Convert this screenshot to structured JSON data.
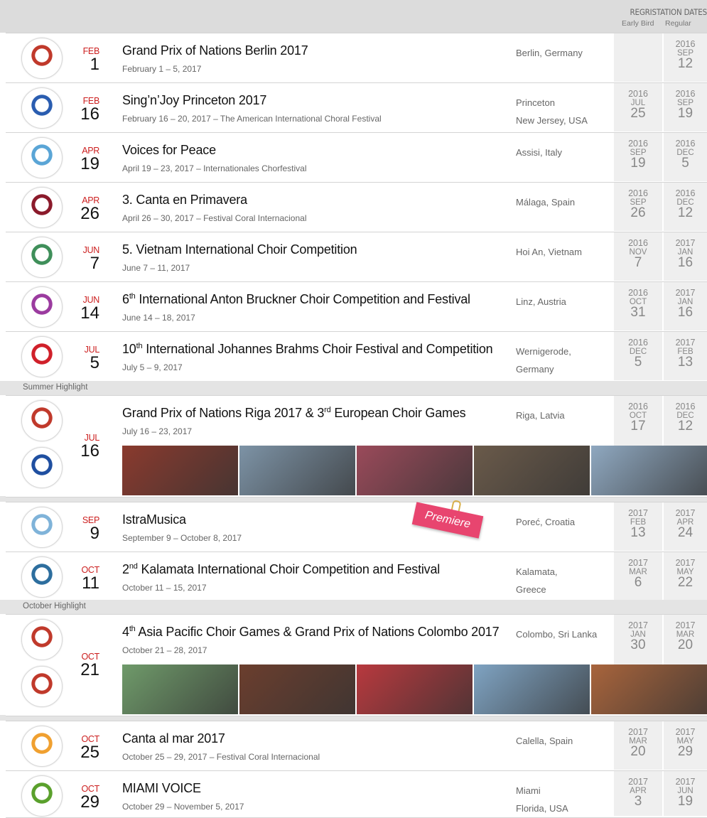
{
  "header": {
    "registration_title": "REGRISTATION DATES",
    "early_bird_label": "Early Bird",
    "regular_label": "Regular"
  },
  "highlights": {
    "summer": "Summer Highlight",
    "october": "October Highlight"
  },
  "premiere_label": "Premiere",
  "events": [
    {
      "logo": "grand-prix-of-nations-logo",
      "logo_color": "#c0392b",
      "month": "FEB",
      "day": "1",
      "title": "Grand Prix of Nations Berlin 2017",
      "title_sup": "",
      "title_rest": "",
      "subtitle": "February 1 – 5, 2017",
      "location_line1": "Berlin, Germany",
      "location_line2": "",
      "early_bird": null,
      "regular": {
        "year": "2016",
        "month": "SEP",
        "day": "12"
      }
    },
    {
      "logo": "sing-n-joy-logo",
      "logo_color": "#2a5db0",
      "month": "FEB",
      "day": "16",
      "title": "Sing’n’Joy Princeton 2017",
      "title_sup": "",
      "title_rest": "",
      "subtitle": "February 16 – 20, 2017 – The American International Choral Festival",
      "location_line1": "Princeton",
      "location_line2": "New Jersey, USA",
      "early_bird": {
        "year": "2016",
        "month": "JUL",
        "day": "25"
      },
      "regular": {
        "year": "2016",
        "month": "SEP",
        "day": "19"
      }
    },
    {
      "logo": "voices-for-peace-dove-logo",
      "logo_color": "#5aa5d6",
      "month": "APR",
      "day": "19",
      "title": "Voices for Peace",
      "title_sup": "",
      "title_rest": "",
      "subtitle": "April 19 – 23, 2017 – Internationales Chorfestival",
      "location_line1": "Assisi, Italy",
      "location_line2": "",
      "early_bird": {
        "year": "2016",
        "month": "SEP",
        "day": "19"
      },
      "regular": {
        "year": "2016",
        "month": "DEC",
        "day": "5"
      }
    },
    {
      "logo": "malaga-logo",
      "logo_color": "#8b1a2b",
      "month": "APR",
      "day": "26",
      "title": "3. Canta en Primavera",
      "title_sup": "",
      "title_rest": "",
      "subtitle": "April 26 – 30, 2017 – Festival Coral Internacional",
      "location_line1": "Málaga, Spain",
      "location_line2": "",
      "early_bird": {
        "year": "2016",
        "month": "SEP",
        "day": "26"
      },
      "regular": {
        "year": "2016",
        "month": "DEC",
        "day": "12"
      }
    },
    {
      "logo": "vietnam-choir-logo",
      "logo_color": "#3f8f5a",
      "month": "JUN",
      "day": "7",
      "title": "5. Vietnam International Choir Competition",
      "title_sup": "",
      "title_rest": "",
      "subtitle": "June 7 – 11, 2017",
      "location_line1": "Hoi An, Vietnam",
      "location_line2": "",
      "early_bird": {
        "year": "2016",
        "month": "NOV",
        "day": "7"
      },
      "regular": {
        "year": "2017",
        "month": "JAN",
        "day": "16"
      }
    },
    {
      "logo": "anton-bruckner-logo",
      "logo_color": "#9b3b9f",
      "month": "JUN",
      "day": "14",
      "title": "6",
      "title_sup": "th",
      "title_rest": " International Anton Bruckner Choir Competition and Festival",
      "subtitle": "June 14 – 18, 2017",
      "location_line1": "Linz, Austria",
      "location_line2": "",
      "early_bird": {
        "year": "2016",
        "month": "OCT",
        "day": "31"
      },
      "regular": {
        "year": "2017",
        "month": "JAN",
        "day": "16"
      }
    },
    {
      "logo": "brahms-10-logo",
      "logo_color": "#d0202a",
      "month": "JUL",
      "day": "5",
      "title": "10",
      "title_sup": "th",
      "title_rest": " International Johannes Brahms Choir Festival and Competition",
      "subtitle": "July 5 – 9, 2017",
      "location_line1": "Wernigerode,",
      "location_line2": "Germany",
      "early_bird": {
        "year": "2016",
        "month": "DEC",
        "day": "5"
      },
      "regular": {
        "year": "2017",
        "month": "FEB",
        "day": "13"
      }
    },
    {
      "logo": "grand-prix-of-nations-logo",
      "logo2": "european-choir-games-logo",
      "logo_color": "#c0392b",
      "logo2_color": "#1f4fa0",
      "month": "JUL",
      "day": "16",
      "title": "Grand Prix of Nations Riga 2017 & 3",
      "title_sup": "rd",
      "title_rest": " European Choir Games",
      "subtitle": "July 16 – 23, 2017",
      "location_line1": "Riga, Latvia",
      "location_line2": "",
      "early_bird": {
        "year": "2016",
        "month": "OCT",
        "day": "17"
      },
      "regular": {
        "year": "2016",
        "month": "DEC",
        "day": "12"
      },
      "photos": [
        "#8a3a2e",
        "#7d93a6",
        "#9a4a5a",
        "#6a5a4a",
        "#8fa8c0"
      ]
    },
    {
      "logo": "istramusica-logo",
      "logo_color": "#7fb3d9",
      "month": "SEP",
      "day": "9",
      "title": "IstraMusica",
      "title_sup": "",
      "title_rest": "",
      "subtitle": "September 9 – October 8, 2017",
      "location_line1": "Poreć, Croatia",
      "location_line2": "",
      "early_bird": {
        "year": "2017",
        "month": "FEB",
        "day": "13"
      },
      "regular": {
        "year": "2017",
        "month": "APR",
        "day": "24"
      }
    },
    {
      "logo": "kalamata-logo",
      "logo_color": "#2d6e9e",
      "month": "OCT",
      "day": "11",
      "title": "2",
      "title_sup": "nd",
      "title_rest": " Kalamata International Choir Competition and Festival",
      "subtitle": "October 11 – 15, 2017",
      "location_line1": "Kalamata,",
      "location_line2": "Greece",
      "early_bird": {
        "year": "2017",
        "month": "MAR",
        "day": "6"
      },
      "regular": {
        "year": "2017",
        "month": "MAY",
        "day": "22"
      }
    },
    {
      "logo": "asia-pacific-choir-games-logo",
      "logo2": "grand-prix-of-nations-logo",
      "logo_color": "#c0392b",
      "logo2_color": "#c0392b",
      "month": "OCT",
      "day": "21",
      "title": "4",
      "title_sup": "th",
      "title_rest": " Asia Pacific Choir Games & Grand Prix of Nations Colombo 2017",
      "subtitle": "October 21 – 28, 2017",
      "location_line1": "Colombo, Sri Lanka",
      "location_line2": "",
      "early_bird": {
        "year": "2017",
        "month": "JAN",
        "day": "30"
      },
      "regular": {
        "year": "2017",
        "month": "MAR",
        "day": "20"
      },
      "photos": [
        "#6f9a6a",
        "#6b3e2e",
        "#b8393e",
        "#7fa3c2",
        "#a8643c"
      ]
    },
    {
      "logo": "canta-al-mar-logo",
      "logo_color": "#f0a030",
      "month": "OCT",
      "day": "25",
      "title": "Canta al mar 2017",
      "title_sup": "",
      "title_rest": "",
      "subtitle": "October 25 – 29, 2017 – Festival Coral Internacional",
      "location_line1": "Calella, Spain",
      "location_line2": "",
      "early_bird": {
        "year": "2017",
        "month": "MAR",
        "day": "20"
      },
      "regular": {
        "year": "2017",
        "month": "MAY",
        "day": "29"
      }
    },
    {
      "logo": "miami-voice-logo",
      "logo_color": "#5aa02c",
      "month": "OCT",
      "day": "29",
      "title": "MIAMI VOICE",
      "title_sup": "",
      "title_rest": "",
      "subtitle": "October 29 – November 5, 2017",
      "location_line1": "Miami",
      "location_line2": "Florida, USA",
      "early_bird": {
        "year": "2017",
        "month": "APR",
        "day": "3"
      },
      "regular": {
        "year": "2017",
        "month": "JUN",
        "day": "19"
      }
    }
  ]
}
